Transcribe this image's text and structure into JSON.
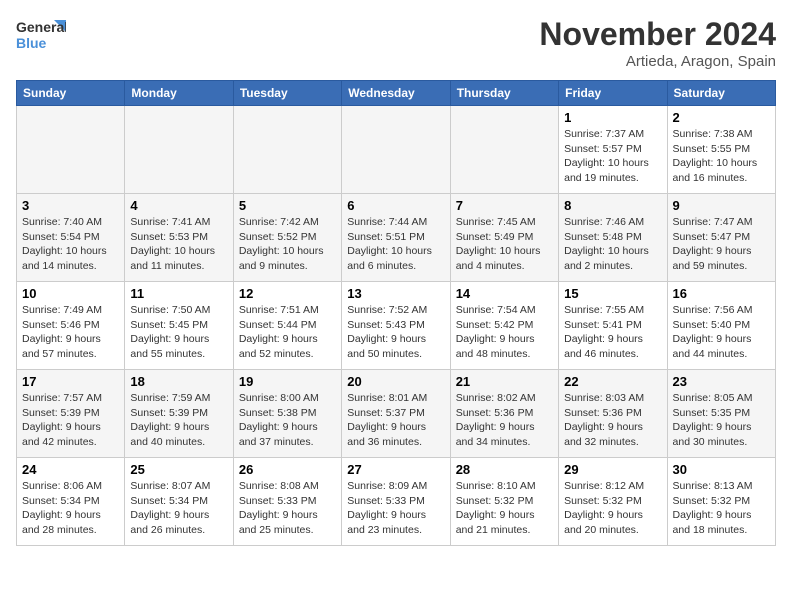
{
  "logo": {
    "text_general": "General",
    "text_blue": "Blue"
  },
  "title": "November 2024",
  "location": "Artieda, Aragon, Spain",
  "weekdays": [
    "Sunday",
    "Monday",
    "Tuesday",
    "Wednesday",
    "Thursday",
    "Friday",
    "Saturday"
  ],
  "weeks": [
    [
      {
        "day": "",
        "empty": true
      },
      {
        "day": "",
        "empty": true
      },
      {
        "day": "",
        "empty": true
      },
      {
        "day": "",
        "empty": true
      },
      {
        "day": "",
        "empty": true
      },
      {
        "day": "1",
        "sunrise": "Sunrise: 7:37 AM",
        "sunset": "Sunset: 5:57 PM",
        "daylight": "Daylight: 10 hours and 19 minutes."
      },
      {
        "day": "2",
        "sunrise": "Sunrise: 7:38 AM",
        "sunset": "Sunset: 5:55 PM",
        "daylight": "Daylight: 10 hours and 16 minutes."
      }
    ],
    [
      {
        "day": "3",
        "sunrise": "Sunrise: 7:40 AM",
        "sunset": "Sunset: 5:54 PM",
        "daylight": "Daylight: 10 hours and 14 minutes."
      },
      {
        "day": "4",
        "sunrise": "Sunrise: 7:41 AM",
        "sunset": "Sunset: 5:53 PM",
        "daylight": "Daylight: 10 hours and 11 minutes."
      },
      {
        "day": "5",
        "sunrise": "Sunrise: 7:42 AM",
        "sunset": "Sunset: 5:52 PM",
        "daylight": "Daylight: 10 hours and 9 minutes."
      },
      {
        "day": "6",
        "sunrise": "Sunrise: 7:44 AM",
        "sunset": "Sunset: 5:51 PM",
        "daylight": "Daylight: 10 hours and 6 minutes."
      },
      {
        "day": "7",
        "sunrise": "Sunrise: 7:45 AM",
        "sunset": "Sunset: 5:49 PM",
        "daylight": "Daylight: 10 hours and 4 minutes."
      },
      {
        "day": "8",
        "sunrise": "Sunrise: 7:46 AM",
        "sunset": "Sunset: 5:48 PM",
        "daylight": "Daylight: 10 hours and 2 minutes."
      },
      {
        "day": "9",
        "sunrise": "Sunrise: 7:47 AM",
        "sunset": "Sunset: 5:47 PM",
        "daylight": "Daylight: 9 hours and 59 minutes."
      }
    ],
    [
      {
        "day": "10",
        "sunrise": "Sunrise: 7:49 AM",
        "sunset": "Sunset: 5:46 PM",
        "daylight": "Daylight: 9 hours and 57 minutes."
      },
      {
        "day": "11",
        "sunrise": "Sunrise: 7:50 AM",
        "sunset": "Sunset: 5:45 PM",
        "daylight": "Daylight: 9 hours and 55 minutes."
      },
      {
        "day": "12",
        "sunrise": "Sunrise: 7:51 AM",
        "sunset": "Sunset: 5:44 PM",
        "daylight": "Daylight: 9 hours and 52 minutes."
      },
      {
        "day": "13",
        "sunrise": "Sunrise: 7:52 AM",
        "sunset": "Sunset: 5:43 PM",
        "daylight": "Daylight: 9 hours and 50 minutes."
      },
      {
        "day": "14",
        "sunrise": "Sunrise: 7:54 AM",
        "sunset": "Sunset: 5:42 PM",
        "daylight": "Daylight: 9 hours and 48 minutes."
      },
      {
        "day": "15",
        "sunrise": "Sunrise: 7:55 AM",
        "sunset": "Sunset: 5:41 PM",
        "daylight": "Daylight: 9 hours and 46 minutes."
      },
      {
        "day": "16",
        "sunrise": "Sunrise: 7:56 AM",
        "sunset": "Sunset: 5:40 PM",
        "daylight": "Daylight: 9 hours and 44 minutes."
      }
    ],
    [
      {
        "day": "17",
        "sunrise": "Sunrise: 7:57 AM",
        "sunset": "Sunset: 5:39 PM",
        "daylight": "Daylight: 9 hours and 42 minutes."
      },
      {
        "day": "18",
        "sunrise": "Sunrise: 7:59 AM",
        "sunset": "Sunset: 5:39 PM",
        "daylight": "Daylight: 9 hours and 40 minutes."
      },
      {
        "day": "19",
        "sunrise": "Sunrise: 8:00 AM",
        "sunset": "Sunset: 5:38 PM",
        "daylight": "Daylight: 9 hours and 37 minutes."
      },
      {
        "day": "20",
        "sunrise": "Sunrise: 8:01 AM",
        "sunset": "Sunset: 5:37 PM",
        "daylight": "Daylight: 9 hours and 36 minutes."
      },
      {
        "day": "21",
        "sunrise": "Sunrise: 8:02 AM",
        "sunset": "Sunset: 5:36 PM",
        "daylight": "Daylight: 9 hours and 34 minutes."
      },
      {
        "day": "22",
        "sunrise": "Sunrise: 8:03 AM",
        "sunset": "Sunset: 5:36 PM",
        "daylight": "Daylight: 9 hours and 32 minutes."
      },
      {
        "day": "23",
        "sunrise": "Sunrise: 8:05 AM",
        "sunset": "Sunset: 5:35 PM",
        "daylight": "Daylight: 9 hours and 30 minutes."
      }
    ],
    [
      {
        "day": "24",
        "sunrise": "Sunrise: 8:06 AM",
        "sunset": "Sunset: 5:34 PM",
        "daylight": "Daylight: 9 hours and 28 minutes."
      },
      {
        "day": "25",
        "sunrise": "Sunrise: 8:07 AM",
        "sunset": "Sunset: 5:34 PM",
        "daylight": "Daylight: 9 hours and 26 minutes."
      },
      {
        "day": "26",
        "sunrise": "Sunrise: 8:08 AM",
        "sunset": "Sunset: 5:33 PM",
        "daylight": "Daylight: 9 hours and 25 minutes."
      },
      {
        "day": "27",
        "sunrise": "Sunrise: 8:09 AM",
        "sunset": "Sunset: 5:33 PM",
        "daylight": "Daylight: 9 hours and 23 minutes."
      },
      {
        "day": "28",
        "sunrise": "Sunrise: 8:10 AM",
        "sunset": "Sunset: 5:32 PM",
        "daylight": "Daylight: 9 hours and 21 minutes."
      },
      {
        "day": "29",
        "sunrise": "Sunrise: 8:12 AM",
        "sunset": "Sunset: 5:32 PM",
        "daylight": "Daylight: 9 hours and 20 minutes."
      },
      {
        "day": "30",
        "sunrise": "Sunrise: 8:13 AM",
        "sunset": "Sunset: 5:32 PM",
        "daylight": "Daylight: 9 hours and 18 minutes."
      }
    ]
  ]
}
